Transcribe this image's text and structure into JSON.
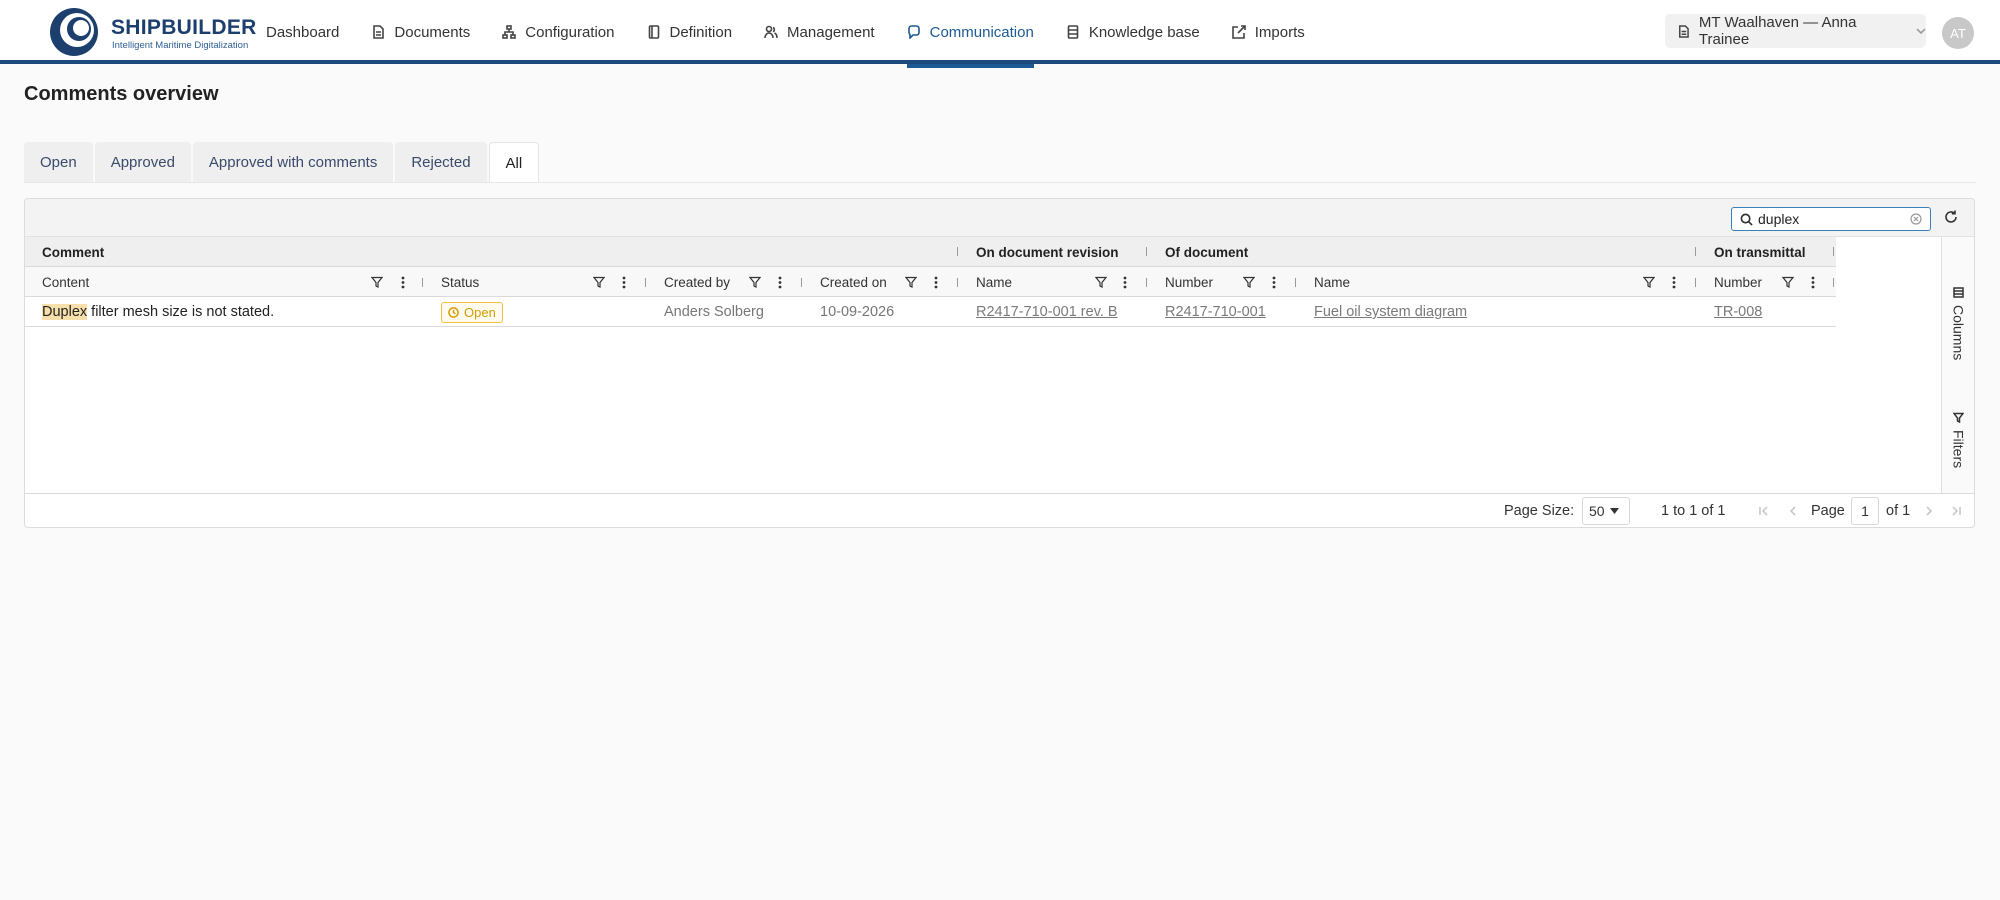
{
  "brand": {
    "name": "SHIPBUILDER",
    "tagline": "Intelligent Maritime Digitalization"
  },
  "nav": [
    {
      "label": "Dashboard",
      "icon": "none"
    },
    {
      "label": "Documents",
      "icon": "document-icon"
    },
    {
      "label": "Configuration",
      "icon": "hierarchy-icon"
    },
    {
      "label": "Definition",
      "icon": "book-icon"
    },
    {
      "label": "Management",
      "icon": "people-icon"
    },
    {
      "label": "Communication",
      "icon": "chat-icon",
      "active": true
    },
    {
      "label": "Knowledge base",
      "icon": "database-icon"
    },
    {
      "label": "Imports",
      "icon": "import-icon"
    }
  ],
  "vessel_selector": "MT Waalhaven — Anna Trainee",
  "user_initials": "AT",
  "page_title": "Comments overview",
  "tabs": [
    "Open",
    "Approved",
    "Approved with comments",
    "Rejected",
    "All"
  ],
  "active_tab": "All",
  "search": {
    "value": "duplex"
  },
  "column_groups": [
    "Comment",
    "On document revision",
    "Of document",
    "On transmittal"
  ],
  "columns": [
    "Content",
    "Status",
    "Created by",
    "Created on",
    "Name",
    "Number",
    "Name",
    "Number"
  ],
  "rows": [
    {
      "content_highlight": "Duplex",
      "content_rest": " filter mesh size is not stated.",
      "status": "Open",
      "created_by": "Anders Solberg",
      "created_on": "10-09-2026",
      "revision_name": "R2417-710-001 rev. B",
      "document_number": "R2417-710-001",
      "document_name": "Fuel oil system diagram",
      "transmittal_number": "TR-008"
    }
  ],
  "side_panel": [
    "Columns",
    "Filters"
  ],
  "pagination": {
    "page_size_label": "Page Size:",
    "page_size": "50",
    "range": "1 to 1 of 1",
    "page_label": "Page",
    "page": "1",
    "of_label": "of 1"
  },
  "colors": {
    "brand": "#1d3f6e",
    "accent": "#1d5a93",
    "status_open": "#d59a00",
    "highlight": "#f6dfaa"
  }
}
